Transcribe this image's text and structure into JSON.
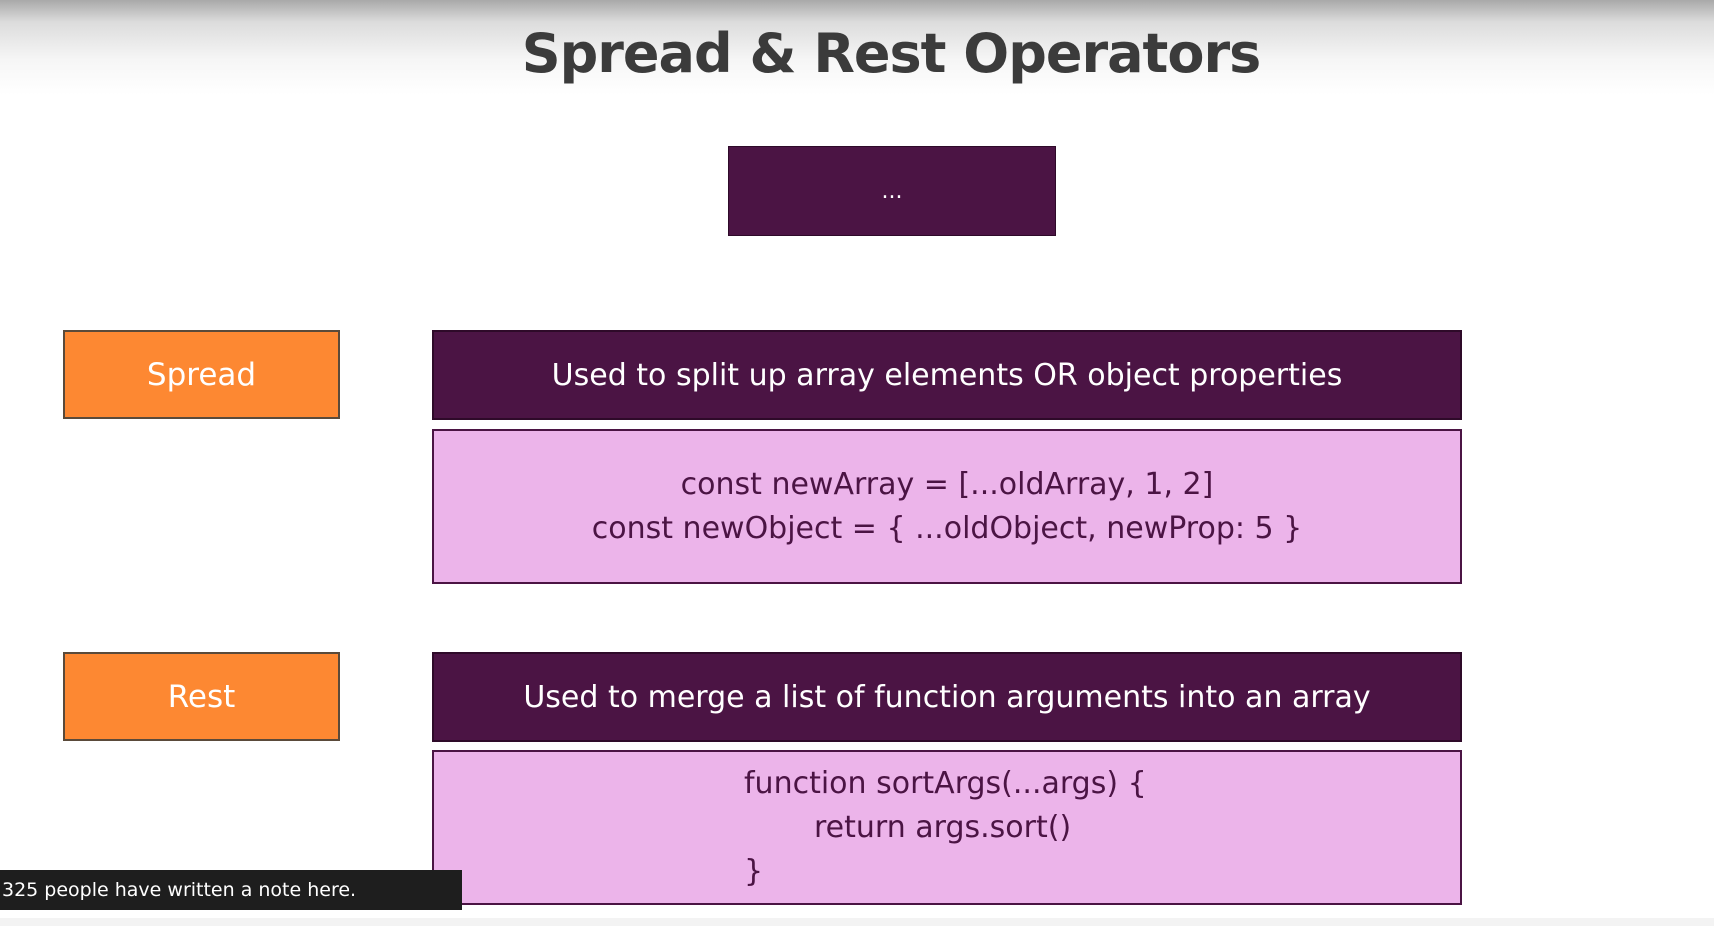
{
  "slide": {
    "title": "Spread & Rest Operators",
    "operator_symbol": "...",
    "spread": {
      "label": "Spread",
      "description": "Used to split up array elements OR object properties",
      "code_lines": [
        "const newArray = [...oldArray, 1, 2]",
        "const newObject = { ...oldObject, newProp: 5 }"
      ]
    },
    "rest": {
      "label": "Rest",
      "description": "Used to merge a list of function arguments into an array",
      "code_lines": [
        "function sortArgs(...args) {",
        "return args.sort()",
        "}"
      ]
    }
  },
  "note_banner": {
    "text": "325 people have written a note here."
  },
  "colors": {
    "dark_purple": "#4b1444",
    "light_pink": "#ecb4ea",
    "orange": "#fd8832",
    "title_gray": "#3b3b3b"
  }
}
